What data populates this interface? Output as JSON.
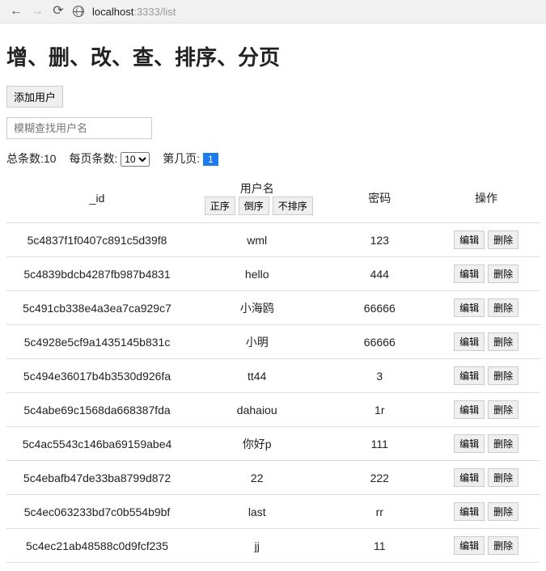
{
  "browser": {
    "host": "localhost",
    "port": ":3333",
    "path": "/list"
  },
  "heading": "增、删、改、查、排序、分页",
  "buttons": {
    "add": "添加用户",
    "edit": "编辑",
    "delete": "删除",
    "sort_asc": "正序",
    "sort_desc": "倒序",
    "sort_none": "不排序"
  },
  "search": {
    "placeholder": "模糊查找用户名"
  },
  "pager": {
    "total_label": "总条数:",
    "total": "10",
    "per_label": "每页条数:",
    "per_value": "10",
    "page_label": "第几页:",
    "page": "1"
  },
  "columns": {
    "id": "_id",
    "user": "用户名",
    "pwd": "密码",
    "ops": "操作"
  },
  "rows": [
    {
      "id": "5c4837f1f0407c891c5d39f8",
      "user": "wml",
      "pwd": "123"
    },
    {
      "id": "5c4839bdcb4287fb987b4831",
      "user": "hello",
      "pwd": "444"
    },
    {
      "id": "5c491cb338e4a3ea7ca929c7",
      "user": "小海鸥",
      "pwd": "66666"
    },
    {
      "id": "5c4928e5cf9a1435145b831c",
      "user": "小明",
      "pwd": "66666"
    },
    {
      "id": "5c494e36017b4b3530d926fa",
      "user": "tt44",
      "pwd": "3"
    },
    {
      "id": "5c4abe69c1568da668387fda",
      "user": "dahaiou",
      "pwd": "1r"
    },
    {
      "id": "5c4ac5543c146ba69159abe4",
      "user": "你好p",
      "pwd": "111"
    },
    {
      "id": "5c4ebafb47de33ba8799d872",
      "user": "22",
      "pwd": "222"
    },
    {
      "id": "5c4ec063233bd7c0b554b9bf",
      "user": "last",
      "pwd": "rr"
    },
    {
      "id": "5c4ec21ab48588c0d9fcf235",
      "user": "jj",
      "pwd": "11"
    }
  ]
}
